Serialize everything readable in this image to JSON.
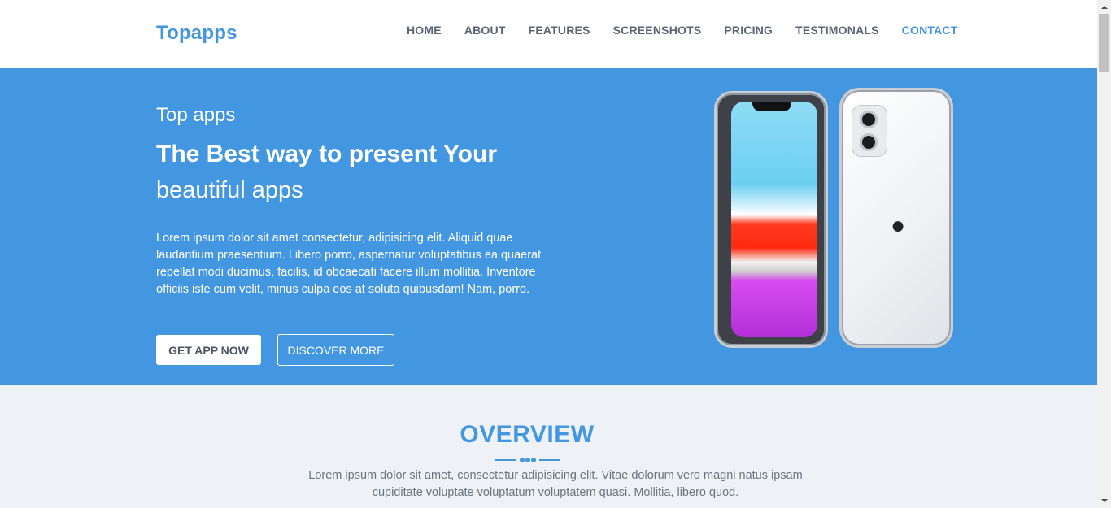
{
  "header": {
    "logo": "Topapps",
    "nav": [
      "HOME",
      "ABOUT",
      "FEATURES",
      "SCREENSHOTS",
      "PRICING",
      "TESTIMONALS",
      "CONTACT"
    ],
    "active_nav": "CONTACT"
  },
  "hero": {
    "eyebrow": "Top apps",
    "headline_strong": "The Best way to present Your",
    "headline_light": "beautiful apps",
    "description": "Lorem ipsum dolor sit amet consectetur, adipisicing elit. Aliquid quae laudantium praesentium. Libero porro, aspernatur voluptatibus ea quaerat repellat modi ducimus, facilis, id obcaecati facere illum mollitia. Inventore officiis iste cum velit, minus culpa eos at soluta quibusdam! Nam, porro.",
    "primary_button": "GET APP NOW",
    "secondary_button": "DISCOVER MORE"
  },
  "overview": {
    "title": "OVERVIEW",
    "text": "Lorem ipsum dolor sit amet, consectetur adipisicing elit. Vitae dolorum vero magni natus ipsam cupiditate voluptate voluptatum voluptatem quasi. Mollitia, libero quod."
  },
  "colors": {
    "brand": "#4396e0",
    "nav_text": "#5a6473",
    "overview_bg": "#eef2f6"
  },
  "icons": {
    "phone_image": "iphone-illustration",
    "apple_logo": "apple-logo-icon"
  }
}
